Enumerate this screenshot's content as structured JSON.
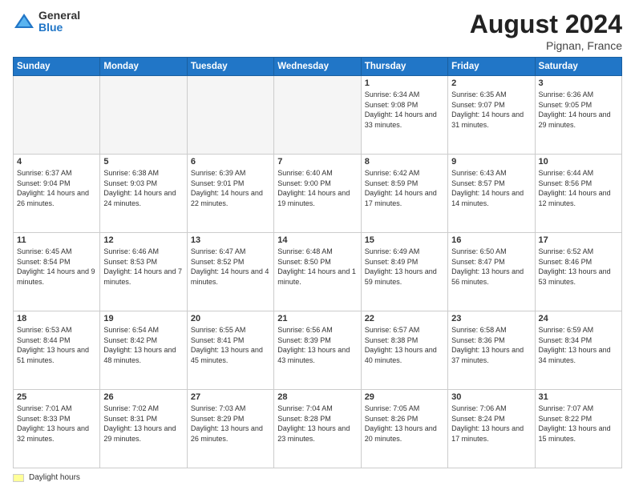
{
  "header": {
    "logo_general": "General",
    "logo_blue": "Blue",
    "title": "August 2024",
    "location": "Pignan, France"
  },
  "days_of_week": [
    "Sunday",
    "Monday",
    "Tuesday",
    "Wednesday",
    "Thursday",
    "Friday",
    "Saturday"
  ],
  "legend": {
    "label": "Daylight hours"
  },
  "weeks": [
    [
      {
        "day": "",
        "empty": true
      },
      {
        "day": "",
        "empty": true
      },
      {
        "day": "",
        "empty": true
      },
      {
        "day": "",
        "empty": true
      },
      {
        "day": "1",
        "sunrise": "Sunrise: 6:34 AM",
        "sunset": "Sunset: 9:08 PM",
        "daylight": "Daylight: 14 hours and 33 minutes."
      },
      {
        "day": "2",
        "sunrise": "Sunrise: 6:35 AM",
        "sunset": "Sunset: 9:07 PM",
        "daylight": "Daylight: 14 hours and 31 minutes."
      },
      {
        "day": "3",
        "sunrise": "Sunrise: 6:36 AM",
        "sunset": "Sunset: 9:05 PM",
        "daylight": "Daylight: 14 hours and 29 minutes."
      }
    ],
    [
      {
        "day": "4",
        "sunrise": "Sunrise: 6:37 AM",
        "sunset": "Sunset: 9:04 PM",
        "daylight": "Daylight: 14 hours and 26 minutes."
      },
      {
        "day": "5",
        "sunrise": "Sunrise: 6:38 AM",
        "sunset": "Sunset: 9:03 PM",
        "daylight": "Daylight: 14 hours and 24 minutes."
      },
      {
        "day": "6",
        "sunrise": "Sunrise: 6:39 AM",
        "sunset": "Sunset: 9:01 PM",
        "daylight": "Daylight: 14 hours and 22 minutes."
      },
      {
        "day": "7",
        "sunrise": "Sunrise: 6:40 AM",
        "sunset": "Sunset: 9:00 PM",
        "daylight": "Daylight: 14 hours and 19 minutes."
      },
      {
        "day": "8",
        "sunrise": "Sunrise: 6:42 AM",
        "sunset": "Sunset: 8:59 PM",
        "daylight": "Daylight: 14 hours and 17 minutes."
      },
      {
        "day": "9",
        "sunrise": "Sunrise: 6:43 AM",
        "sunset": "Sunset: 8:57 PM",
        "daylight": "Daylight: 14 hours and 14 minutes."
      },
      {
        "day": "10",
        "sunrise": "Sunrise: 6:44 AM",
        "sunset": "Sunset: 8:56 PM",
        "daylight": "Daylight: 14 hours and 12 minutes."
      }
    ],
    [
      {
        "day": "11",
        "sunrise": "Sunrise: 6:45 AM",
        "sunset": "Sunset: 8:54 PM",
        "daylight": "Daylight: 14 hours and 9 minutes."
      },
      {
        "day": "12",
        "sunrise": "Sunrise: 6:46 AM",
        "sunset": "Sunset: 8:53 PM",
        "daylight": "Daylight: 14 hours and 7 minutes."
      },
      {
        "day": "13",
        "sunrise": "Sunrise: 6:47 AM",
        "sunset": "Sunset: 8:52 PM",
        "daylight": "Daylight: 14 hours and 4 minutes."
      },
      {
        "day": "14",
        "sunrise": "Sunrise: 6:48 AM",
        "sunset": "Sunset: 8:50 PM",
        "daylight": "Daylight: 14 hours and 1 minute."
      },
      {
        "day": "15",
        "sunrise": "Sunrise: 6:49 AM",
        "sunset": "Sunset: 8:49 PM",
        "daylight": "Daylight: 13 hours and 59 minutes."
      },
      {
        "day": "16",
        "sunrise": "Sunrise: 6:50 AM",
        "sunset": "Sunset: 8:47 PM",
        "daylight": "Daylight: 13 hours and 56 minutes."
      },
      {
        "day": "17",
        "sunrise": "Sunrise: 6:52 AM",
        "sunset": "Sunset: 8:46 PM",
        "daylight": "Daylight: 13 hours and 53 minutes."
      }
    ],
    [
      {
        "day": "18",
        "sunrise": "Sunrise: 6:53 AM",
        "sunset": "Sunset: 8:44 PM",
        "daylight": "Daylight: 13 hours and 51 minutes."
      },
      {
        "day": "19",
        "sunrise": "Sunrise: 6:54 AM",
        "sunset": "Sunset: 8:42 PM",
        "daylight": "Daylight: 13 hours and 48 minutes."
      },
      {
        "day": "20",
        "sunrise": "Sunrise: 6:55 AM",
        "sunset": "Sunset: 8:41 PM",
        "daylight": "Daylight: 13 hours and 45 minutes."
      },
      {
        "day": "21",
        "sunrise": "Sunrise: 6:56 AM",
        "sunset": "Sunset: 8:39 PM",
        "daylight": "Daylight: 13 hours and 43 minutes."
      },
      {
        "day": "22",
        "sunrise": "Sunrise: 6:57 AM",
        "sunset": "Sunset: 8:38 PM",
        "daylight": "Daylight: 13 hours and 40 minutes."
      },
      {
        "day": "23",
        "sunrise": "Sunrise: 6:58 AM",
        "sunset": "Sunset: 8:36 PM",
        "daylight": "Daylight: 13 hours and 37 minutes."
      },
      {
        "day": "24",
        "sunrise": "Sunrise: 6:59 AM",
        "sunset": "Sunset: 8:34 PM",
        "daylight": "Daylight: 13 hours and 34 minutes."
      }
    ],
    [
      {
        "day": "25",
        "sunrise": "Sunrise: 7:01 AM",
        "sunset": "Sunset: 8:33 PM",
        "daylight": "Daylight: 13 hours and 32 minutes."
      },
      {
        "day": "26",
        "sunrise": "Sunrise: 7:02 AM",
        "sunset": "Sunset: 8:31 PM",
        "daylight": "Daylight: 13 hours and 29 minutes."
      },
      {
        "day": "27",
        "sunrise": "Sunrise: 7:03 AM",
        "sunset": "Sunset: 8:29 PM",
        "daylight": "Daylight: 13 hours and 26 minutes."
      },
      {
        "day": "28",
        "sunrise": "Sunrise: 7:04 AM",
        "sunset": "Sunset: 8:28 PM",
        "daylight": "Daylight: 13 hours and 23 minutes."
      },
      {
        "day": "29",
        "sunrise": "Sunrise: 7:05 AM",
        "sunset": "Sunset: 8:26 PM",
        "daylight": "Daylight: 13 hours and 20 minutes."
      },
      {
        "day": "30",
        "sunrise": "Sunrise: 7:06 AM",
        "sunset": "Sunset: 8:24 PM",
        "daylight": "Daylight: 13 hours and 17 minutes."
      },
      {
        "day": "31",
        "sunrise": "Sunrise: 7:07 AM",
        "sunset": "Sunset: 8:22 PM",
        "daylight": "Daylight: 13 hours and 15 minutes."
      }
    ]
  ]
}
